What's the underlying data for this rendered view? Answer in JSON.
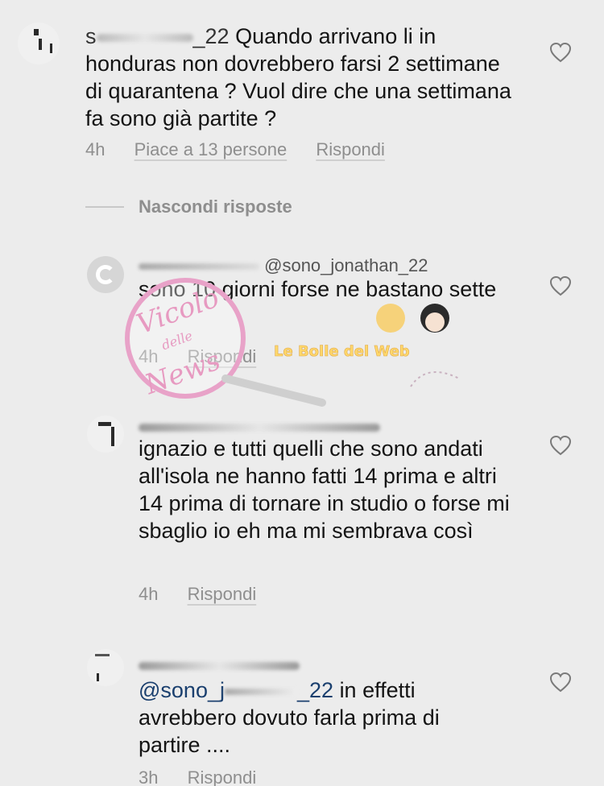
{
  "colors": {
    "background": "#ececec",
    "text": "#141414",
    "meta": "#8e8e8e",
    "mention": "#1a3f6e",
    "watermark_pink": "#e8a2c8"
  },
  "comments": [
    {
      "user_prefix": "s",
      "user_suffix": "_22",
      "text": "Quando arrivano li in honduras non dovrebbero farsi 2 settimane di quarantena ? Vuol dire che una settimana fa sono già partite ?",
      "time": "4h",
      "likes": "Piace a 13 persone",
      "reply": "Rispondi"
    },
    {
      "text": "sono 10 giorni forse ne bastano sette",
      "mention_prefix": "@sono_jonathan_22",
      "time": "4h",
      "reply": "Rispondi"
    },
    {
      "text": "ignazio e tutti quelli che sono andati all'isola ne hanno fatti 14 prima e altri 14 prima di tornare in studio o forse mi sbaglio io eh ma mi sembrava così",
      "time": "4h",
      "reply": "Rispondi"
    },
    {
      "mention": "@sono_j",
      "mention_end": "_22",
      "text": "in effetti avrebbero dovuto farla prima di partire ....",
      "time": "3h",
      "reply": "Rispondi"
    }
  ],
  "hide_replies": "Nascondi risposte",
  "watermark": {
    "brand_line1": "Vicolo",
    "brand_line2": "delle",
    "brand_line3": "News",
    "tagline": "Le Bolle del Web"
  },
  "icons": {
    "like": "heart-outline-icon"
  }
}
